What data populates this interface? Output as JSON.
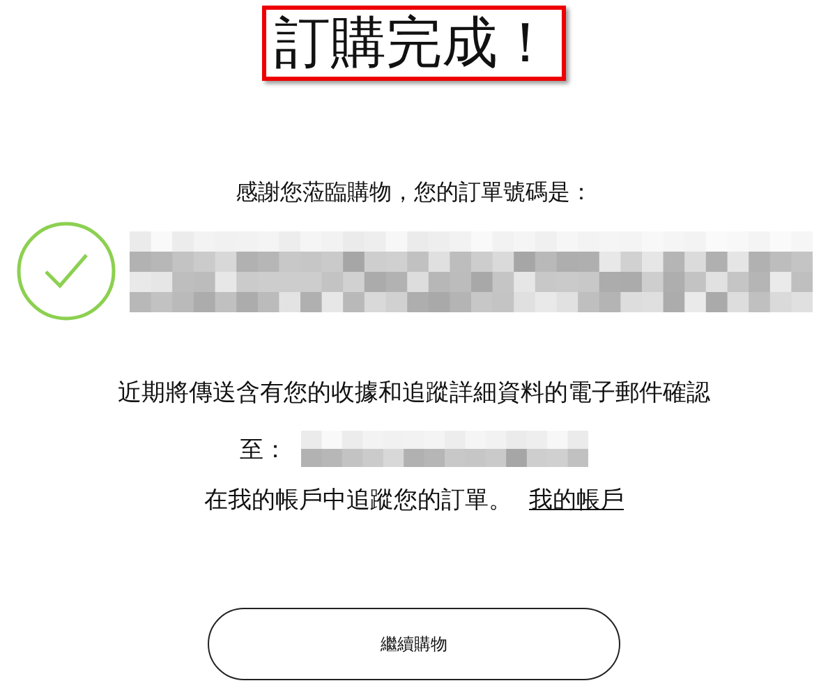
{
  "title": "訂購完成！",
  "thanks": "感謝您蒞臨購物，您的訂單號碼是：",
  "email_notice": "近期將傳送含有您的收據和追蹤詳細資料的電子郵件確認",
  "email_to": "至：",
  "track": {
    "text": "在我的帳戶中追蹤您的訂單。",
    "link": "我的帳戶"
  },
  "button": "繼續購物"
}
